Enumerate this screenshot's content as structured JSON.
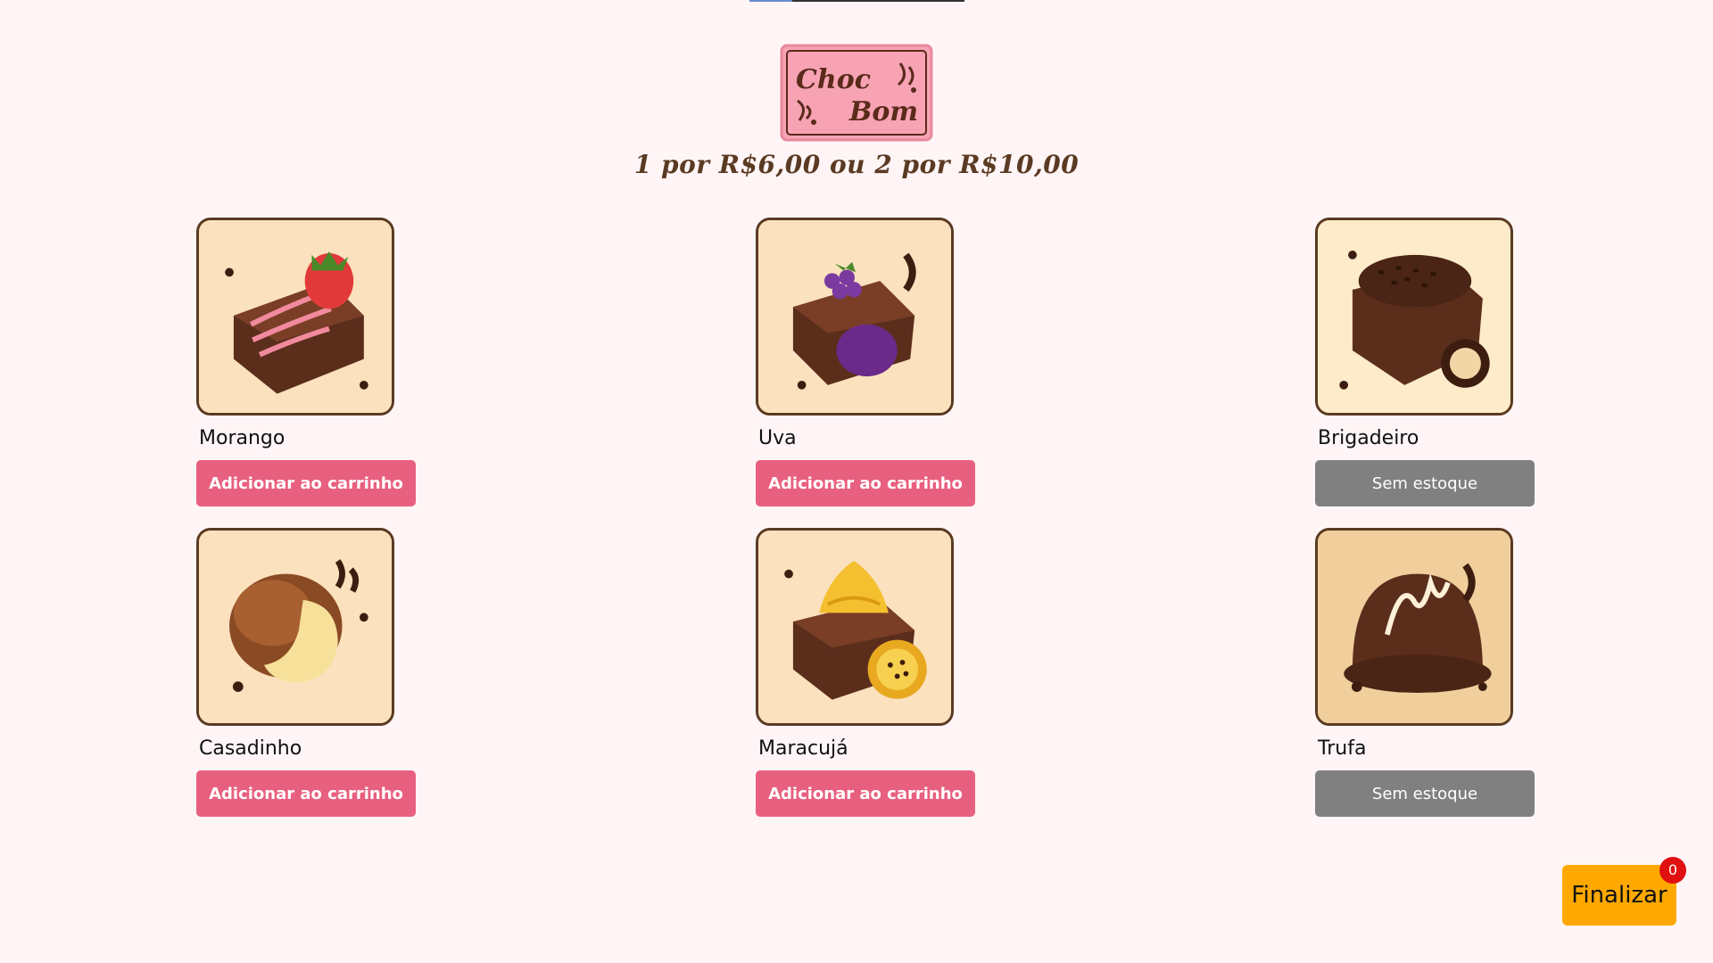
{
  "logo": {
    "line1": "Choc",
    "line2": "Bom"
  },
  "promo_text": "1 por R$6,00 ou 2 por R$10,00",
  "products": [
    {
      "name": "Morango",
      "button": "Adicionar ao carrinho",
      "in_stock": true,
      "icon": "strawberry-chocolate-icon"
    },
    {
      "name": "Uva",
      "button": "Adicionar ao carrinho",
      "in_stock": true,
      "icon": "grape-chocolate-icon"
    },
    {
      "name": "Brigadeiro",
      "button": "Sem estoque",
      "in_stock": false,
      "icon": "brigadeiro-chocolate-icon"
    },
    {
      "name": "Casadinho",
      "button": "Adicionar ao carrinho",
      "in_stock": true,
      "icon": "casadinho-cookie-icon"
    },
    {
      "name": "Maracujá",
      "button": "Adicionar ao carrinho",
      "in_stock": true,
      "icon": "passion-fruit-chocolate-icon"
    },
    {
      "name": "Trufa",
      "button": "Sem estoque",
      "in_stock": false,
      "icon": "truffle-chocolate-icon"
    }
  ],
  "cart": {
    "finalize_label": "Finalizar",
    "count": "0"
  },
  "colors": {
    "background": "#fff5f6",
    "add_button": "#e8607f",
    "out_of_stock_button": "#808080",
    "finalize_button": "#ffa800",
    "badge": "#e01010",
    "chocolate": "#5a3a22"
  }
}
